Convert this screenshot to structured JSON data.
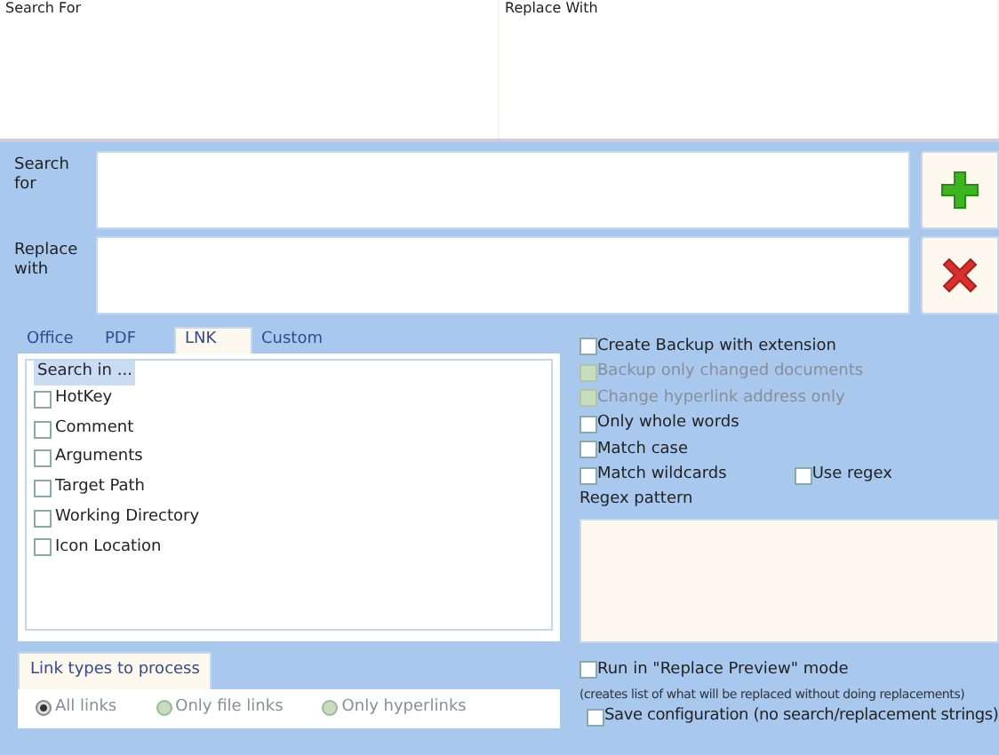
{
  "grid_columns": [
    {
      "label": "Search For"
    },
    {
      "label": "Replace With"
    }
  ],
  "search": {
    "label": "Search for"
  },
  "replace": {
    "label": "Replace with"
  },
  "actions": [
    {
      "kind": "add"
    },
    {
      "kind": "remove"
    }
  ],
  "tabs": [
    {
      "label": "Office",
      "selected": false
    },
    {
      "label": "PDF",
      "selected": false
    },
    {
      "label": "LNK",
      "selected": true
    },
    {
      "label": "Custom",
      "selected": false
    }
  ],
  "search_in": {
    "legend": "Search in ...",
    "options": [
      {
        "label": "HotKey",
        "checked": false
      },
      {
        "label": "Comment",
        "checked": false
      },
      {
        "label": "Arguments",
        "checked": false
      },
      {
        "label": "Target Path",
        "checked": false
      },
      {
        "label": "Working Directory",
        "checked": false
      },
      {
        "label": "Icon Location",
        "checked": false
      }
    ]
  },
  "link_types": {
    "title": "Link types to process",
    "options": [
      {
        "label": "All links",
        "selected": true
      },
      {
        "label": "Only file links",
        "selected": false
      },
      {
        "label": "Only hyperlinks",
        "selected": false
      }
    ]
  },
  "options": [
    {
      "label": "Create Backup with extension",
      "checked": false,
      "disabled": false
    },
    {
      "label": "Backup only changed documents",
      "checked": false,
      "disabled": true
    },
    {
      "label": "Change hyperlink address only",
      "checked": false,
      "disabled": true
    },
    {
      "label": "Only whole words",
      "checked": false,
      "disabled": false
    },
    {
      "label": "Match case",
      "checked": false,
      "disabled": false
    },
    {
      "label": "Match wildcards",
      "checked": false,
      "disabled": false
    }
  ],
  "use_regex": {
    "label": "Use regex",
    "checked": false
  },
  "regex_pattern": {
    "label": "Regex pattern"
  },
  "preview": {
    "label": "Run in \"Replace Preview\" mode",
    "checked": false,
    "note": "(creates list of what will be replaced without doing replacements)"
  },
  "save_config": {
    "label": "Save configuration (no search/replacement strings)",
    "checked": false
  }
}
